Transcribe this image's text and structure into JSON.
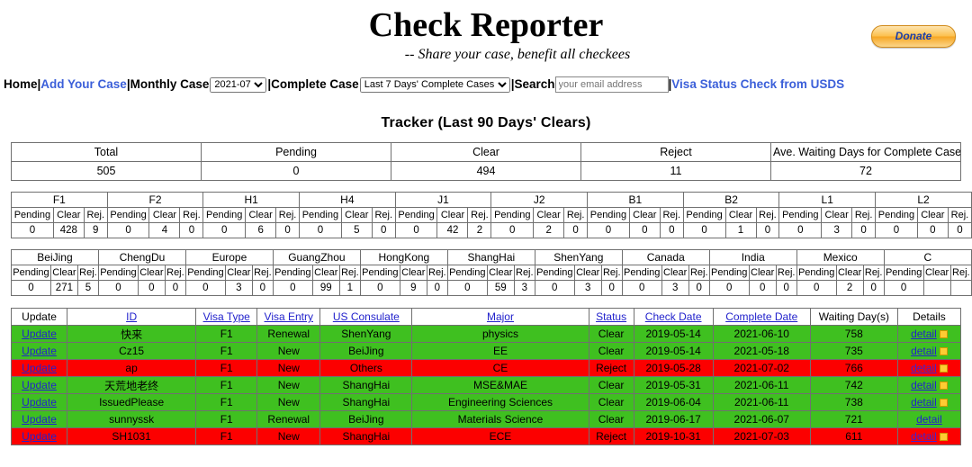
{
  "header": {
    "title": "Check Reporter",
    "subtitle": "-- Share your case, benefit all checkees",
    "donate_label": "Donate"
  },
  "nav": {
    "home": "Home",
    "add_your_case": "Add Your Case",
    "monthly_case_label": "Monthly Case",
    "monthly_case_value": "2021-07",
    "complete_case_label": "Complete Case",
    "complete_case_value": "Last 7 Days' Complete Cases",
    "search_label": "Search",
    "search_placeholder": "your email address",
    "search_value": "",
    "usds_link": "Visa Status Check from USDS",
    "separator": "|"
  },
  "tracker": {
    "heading": "Tracker (Last 90 Days' Clears)",
    "summary_headers": [
      "Total",
      "Pending",
      "Clear",
      "Reject",
      "Ave. Waiting Days for Complete Cases"
    ],
    "summary_values": [
      "505",
      "0",
      "494",
      "11",
      "72"
    ]
  },
  "visa_grid": {
    "sub_headers": [
      "Pending",
      "Clear",
      "Rej."
    ],
    "groups": [
      {
        "name": "F1",
        "pending": "0",
        "clear": "428",
        "reject": "9"
      },
      {
        "name": "F2",
        "pending": "0",
        "clear": "4",
        "reject": "0"
      },
      {
        "name": "H1",
        "pending": "0",
        "clear": "6",
        "reject": "0"
      },
      {
        "name": "H4",
        "pending": "0",
        "clear": "5",
        "reject": "0"
      },
      {
        "name": "J1",
        "pending": "0",
        "clear": "42",
        "reject": "2"
      },
      {
        "name": "J2",
        "pending": "0",
        "clear": "2",
        "reject": "0"
      },
      {
        "name": "B1",
        "pending": "0",
        "clear": "0",
        "reject": "0"
      },
      {
        "name": "B2",
        "pending": "0",
        "clear": "1",
        "reject": "0"
      },
      {
        "name": "L1",
        "pending": "0",
        "clear": "3",
        "reject": "0"
      },
      {
        "name": "L2",
        "pending": "0",
        "clear": "0",
        "reject": "0"
      }
    ]
  },
  "city_grid": {
    "sub_headers": [
      "Pending",
      "Clear",
      "Rej."
    ],
    "groups": [
      {
        "name": "BeiJing",
        "pending": "0",
        "clear": "271",
        "reject": "5"
      },
      {
        "name": "ChengDu",
        "pending": "0",
        "clear": "0",
        "reject": "0"
      },
      {
        "name": "Europe",
        "pending": "0",
        "clear": "3",
        "reject": "0"
      },
      {
        "name": "GuangZhou",
        "pending": "0",
        "clear": "99",
        "reject": "1"
      },
      {
        "name": "HongKong",
        "pending": "0",
        "clear": "9",
        "reject": "0"
      },
      {
        "name": "ShangHai",
        "pending": "0",
        "clear": "59",
        "reject": "3"
      },
      {
        "name": "ShenYang",
        "pending": "0",
        "clear": "3",
        "reject": "0"
      },
      {
        "name": "Canada",
        "pending": "0",
        "clear": "3",
        "reject": "0"
      },
      {
        "name": "India",
        "pending": "0",
        "clear": "0",
        "reject": "0"
      },
      {
        "name": "Mexico",
        "pending": "0",
        "clear": "2",
        "reject": "0"
      },
      {
        "name": "C",
        "pending": "0",
        "clear": "",
        "reject": ""
      }
    ]
  },
  "cases_table": {
    "headers": [
      "Update",
      "ID",
      "Visa Type",
      "Visa Entry",
      "US Consulate",
      "Major",
      "Status",
      "Check Date",
      "Complete Date",
      "Waiting Day(s)",
      "Details"
    ],
    "update_label": "Update",
    "detail_label": "detail",
    "rows": [
      {
        "id": "快来",
        "visa_type": "F1",
        "visa_entry": "Renewal",
        "consulate": "ShenYang",
        "major": "physics",
        "status": "Clear",
        "check_date": "2019-05-14",
        "complete_date": "2021-06-10",
        "waiting_days": "758",
        "state": "clear",
        "has_flag": true
      },
      {
        "id": "Cz15",
        "visa_type": "F1",
        "visa_entry": "New",
        "consulate": "BeiJing",
        "major": "EE",
        "status": "Clear",
        "check_date": "2019-05-14",
        "complete_date": "2021-05-18",
        "waiting_days": "735",
        "state": "clear",
        "has_flag": true
      },
      {
        "id": "ap",
        "visa_type": "F1",
        "visa_entry": "New",
        "consulate": "Others",
        "major": "CE",
        "status": "Reject",
        "check_date": "2019-05-28",
        "complete_date": "2021-07-02",
        "waiting_days": "766",
        "state": "reject",
        "has_flag": true
      },
      {
        "id": "天荒地老终",
        "visa_type": "F1",
        "visa_entry": "New",
        "consulate": "ShangHai",
        "major": "MSE&MAE",
        "status": "Clear",
        "check_date": "2019-05-31",
        "complete_date": "2021-06-11",
        "waiting_days": "742",
        "state": "clear",
        "has_flag": true
      },
      {
        "id": "IssuedPlease",
        "visa_type": "F1",
        "visa_entry": "New",
        "consulate": "ShangHai",
        "major": "Engineering Sciences",
        "status": "Clear",
        "check_date": "2019-06-04",
        "complete_date": "2021-06-11",
        "waiting_days": "738",
        "state": "clear",
        "has_flag": true
      },
      {
        "id": "sunnyssk",
        "visa_type": "F1",
        "visa_entry": "Renewal",
        "consulate": "BeiJing",
        "major": "Materials Science",
        "status": "Clear",
        "check_date": "2019-06-17",
        "complete_date": "2021-06-07",
        "waiting_days": "721",
        "state": "clear",
        "has_flag": false
      },
      {
        "id": "SH1031",
        "visa_type": "F1",
        "visa_entry": "New",
        "consulate": "ShangHai",
        "major": "ECE",
        "status": "Reject",
        "check_date": "2019-10-31",
        "complete_date": "2021-07-03",
        "waiting_days": "611",
        "state": "reject",
        "has_flag": true
      }
    ]
  },
  "colors": {
    "clear_row": "#3fc020",
    "reject_row": "#fc0000",
    "link": "#2222cc",
    "nav_link": "#3b5fd9",
    "flag": "#ffcc33"
  }
}
